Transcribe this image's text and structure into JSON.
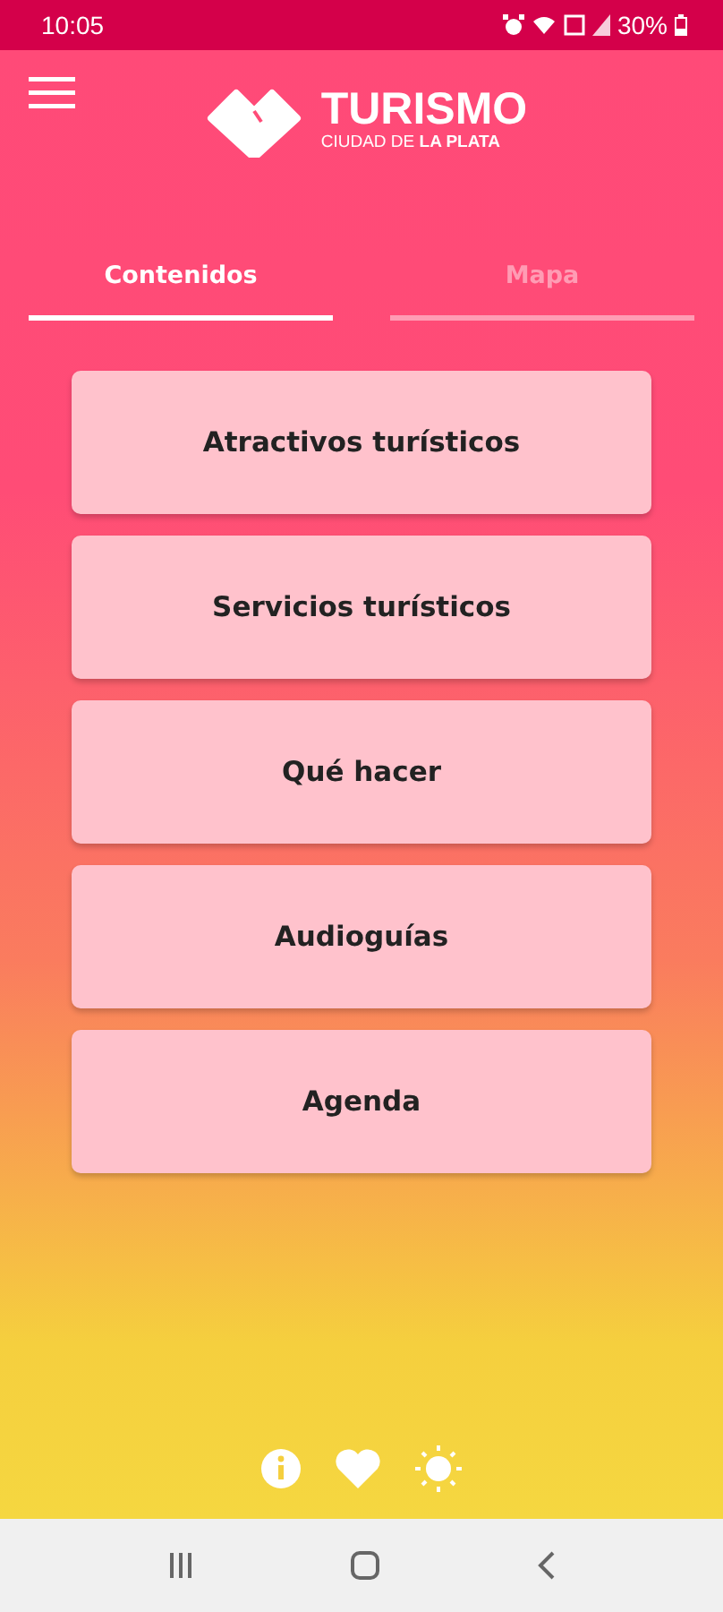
{
  "status_bar": {
    "time": "10:05",
    "battery": "30%"
  },
  "logo": {
    "title": "TURISMO",
    "subtitle": "CIUDAD DE **LA PLATA**"
  },
  "tabs": [
    {
      "label": "Contenidos",
      "selected": true
    },
    {
      "label": "Mapa",
      "selected": false
    }
  ],
  "menu": [
    "Atractivos turísticos",
    "Servicios turísticos",
    "Qué hacer",
    "Audioguías",
    "Agenda"
  ]
}
